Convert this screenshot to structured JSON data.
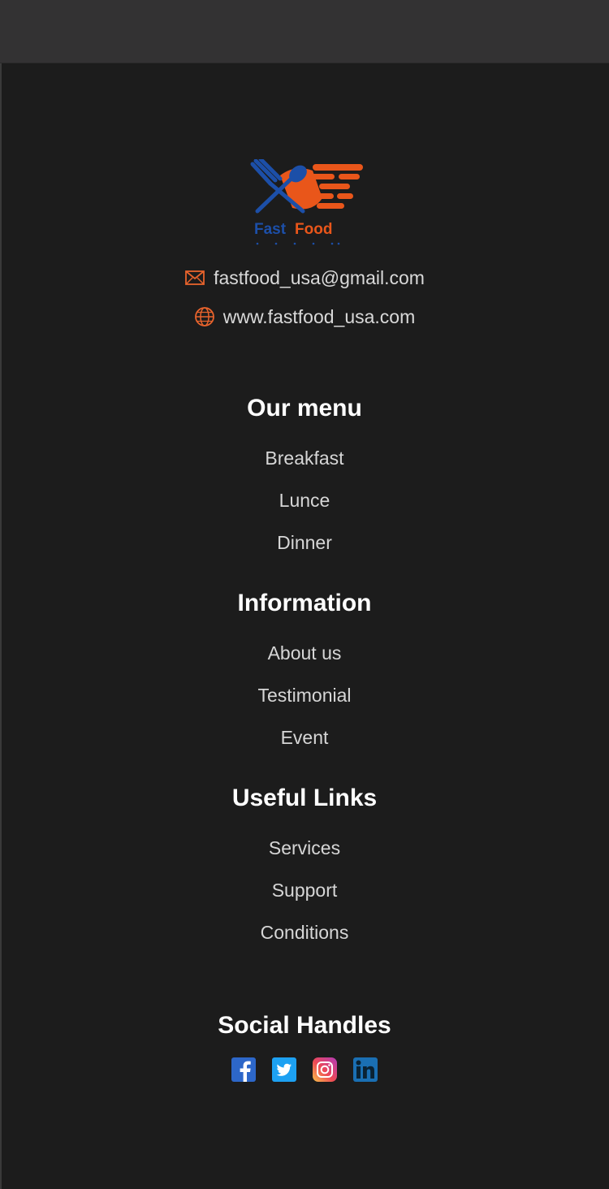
{
  "brand": {
    "logo_text": "Fast Food",
    "logo_colors": {
      "blue": "#1c4fa8",
      "orange": "#e9561a"
    }
  },
  "contact": {
    "email": "fastfood_usa@gmail.com",
    "website": "www.fastfood_usa.com",
    "icon_color": "#e8632c"
  },
  "sections": {
    "menu": {
      "title": "Our menu",
      "links": [
        "Breakfast",
        "Lunce",
        "Dinner"
      ]
    },
    "information": {
      "title": "Information",
      "links": [
        "About us",
        "Testimonial",
        "Event"
      ]
    },
    "useful": {
      "title": "Useful Links",
      "links": [
        "Services",
        "Support",
        "Conditions"
      ]
    }
  },
  "social": {
    "title": "Social Handles",
    "icons": [
      "facebook-icon",
      "twitter-icon",
      "instagram-icon",
      "linkedin-icon"
    ]
  }
}
